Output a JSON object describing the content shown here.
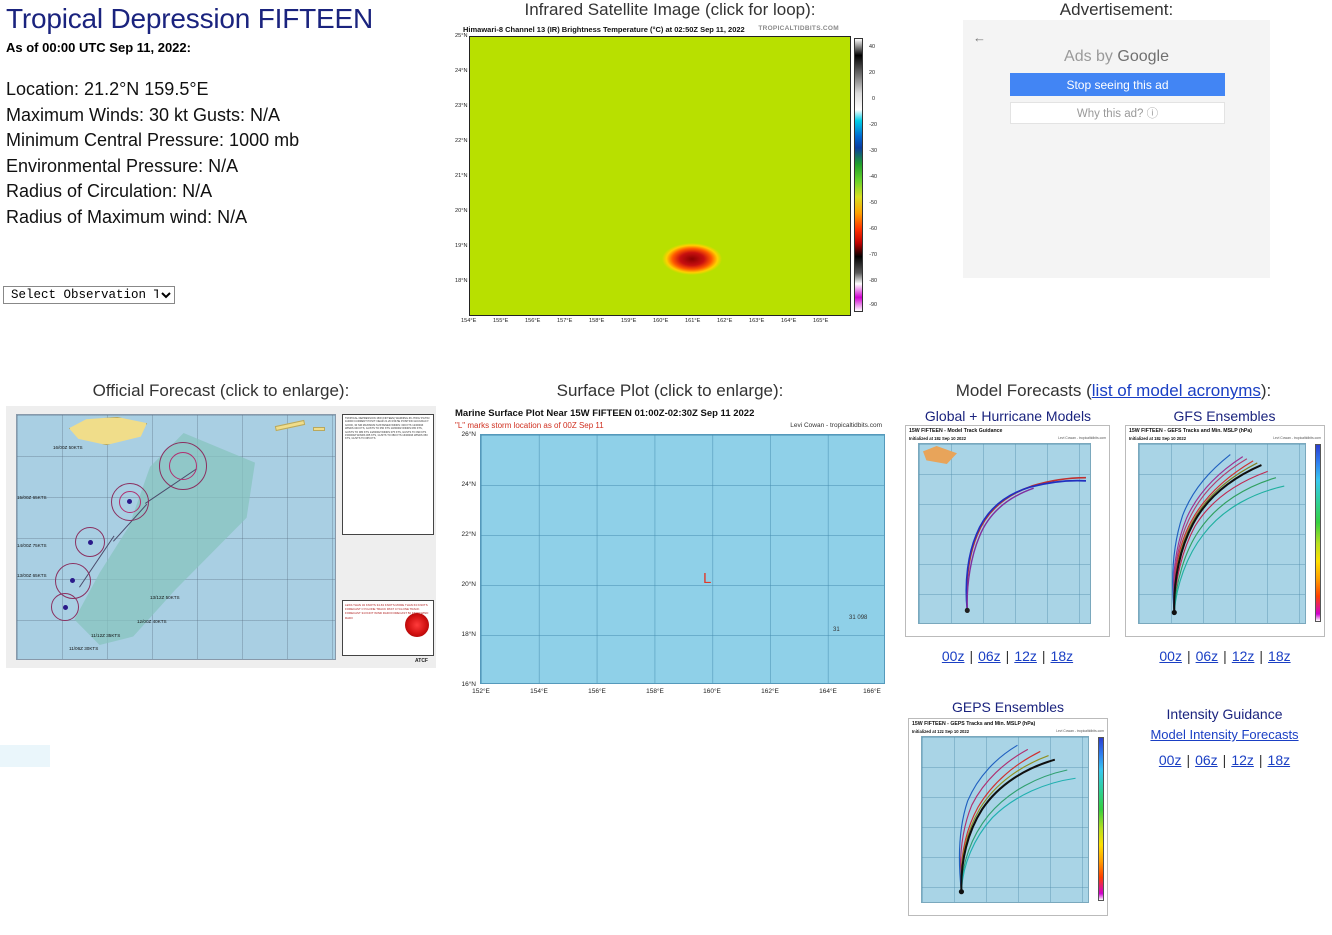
{
  "storm": {
    "title": "Tropical Depression FIFTEEN",
    "as_of": "As of 00:00 UTC Sep 11, 2022:",
    "lines": [
      "Location: 21.2°N 159.5°E",
      "Maximum Winds: 30 kt  Gusts: N/A",
      "Minimum Central Pressure: 1000 mb",
      "Environmental Pressure: N/A",
      "Radius of Circulation: N/A",
      "Radius of Maximum wind: N/A"
    ]
  },
  "satellite": {
    "heading": "Infrared Satellite Image (click for loop):",
    "image_title": "Himawari-8 Channel 13 (IR) Brightness Temperature (°C) at 02:50Z Sep 11, 2022",
    "credit": "TROPICALTIDBITS.COM",
    "y_ticks": [
      "25°N",
      "24°N",
      "23°N",
      "22°N",
      "21°N",
      "20°N",
      "19°N",
      "18°N"
    ],
    "x_ticks": [
      "154°E",
      "155°E",
      "156°E",
      "157°E",
      "158°E",
      "159°E",
      "160°E",
      "161°E",
      "162°E",
      "163°E",
      "164°E",
      "165°E"
    ],
    "colorbar_ticks": [
      "40",
      "20",
      "0",
      "-20",
      "-30",
      "-40",
      "-50",
      "-60",
      "-70",
      "-80",
      "-90"
    ]
  },
  "advertisement": {
    "heading": "Advertisement:",
    "back_icon": "back-arrow-icon",
    "ads_by": "Ads by ",
    "ads_by_brand": "Google",
    "stop_button": "Stop seeing this ad",
    "why_button": "Why this ad? ⓘ"
  },
  "forecast": {
    "heading": "Official Forecast (click to enlarge):",
    "atcf_label": "ATCF",
    "track_labels": [
      "16/00Z  50KTS",
      "15/00Z  65KTS",
      "14/00Z  75KTS",
      "13/00Z  65KTS",
      "13/12Z  50KTS",
      "12/00Z  40KTS",
      "11/12Z  35KTS",
      "11/06Z  30KTS"
    ],
    "info_text": "TROPICAL DEPRESSION 15W (FIFTEEN) WARNING #6\nJTWC/ PGTW/ 110000\nCURRENT POSIT: NEAR 21.2N 159.5E\nPOSITION ACCURACY: GOOD, 30 NM\nMAXIMUM SUSTAINED WINDS: 030 KTS\n12/0000Z WINDS 040 KTS, GUSTS TO 050 KTS\n13/0000Z WINDS 065 KTS, GUSTS TO 080 KTS\n14/0000Z WINDS 075 KTS, GUSTS TO 090 KTS\n15/0000Z WINDS 065 KTS, GUSTS TO 080 KTS\n16/0000Z WINDS 050 KTS, GUSTS TO 065 KTS",
    "legend_text": "LESS THAN 34 KNOTS\n34-63 KNOTS\nMORE THAN 63 KNOTS\nFORECAST CYCLONE TRACK\nPAST CYCLONE TRACK\nFORECAST 34 KNOT WIND RADII\nFORECAST 50 KNOT WIND RADII"
  },
  "surface": {
    "heading": "Surface Plot (click to enlarge):",
    "title": "Marine Surface Plot Near 15W FIFTEEN 01:00Z-02:30Z Sep 11 2022",
    "subtitle": "\"L\" marks storm location as of 00Z Sep 11",
    "credit": "Levi Cowan - tropicaltidbits.com",
    "low_marker": "L",
    "y_ticks": [
      "26°N",
      "24°N",
      "22°N",
      "20°N",
      "18°N",
      "16°N"
    ],
    "x_ticks": [
      "152°E",
      "154°E",
      "156°E",
      "158°E",
      "160°E",
      "162°E",
      "164°E",
      "166°E"
    ],
    "station_values": [
      "31",
      "098",
      "31"
    ],
    "select_value": "Select Observation Time...",
    "select_options": [
      "Select Observation Time..."
    ]
  },
  "models": {
    "heading_prefix": "Model Forecasts (",
    "heading_link": "list of model acronyms",
    "heading_suffix": "):",
    "global_models": {
      "label": "Global + Hurricane Models",
      "chart_title": "15W FIFTEEN - Model Track Guidance",
      "chart_sub": "Initialized at 18z Sep 10 2022",
      "credit": "Levi Cowan - tropicaltidbits.com",
      "times": [
        "00z",
        "06z",
        "12z",
        "18z"
      ]
    },
    "gfs_ensembles": {
      "label": "GFS Ensembles",
      "chart_title": "15W FIFTEEN - GEFS Tracks and Min. MSLP (hPa)",
      "chart_sub": "Initialized at 18z Sep 10 2022",
      "credit": "Levi Cowan - tropicaltidbits.com",
      "times": [
        "00z",
        "06z",
        "12z",
        "18z"
      ]
    },
    "geps_ensembles": {
      "label": "GEPS Ensembles",
      "chart_title": "15W FIFTEEN - GEPS Tracks and Min. MSLP (hPa)",
      "chart_sub": "Initialized at 12z Sep 10 2022",
      "credit": "Levi Cowan - tropicaltidbits.com"
    },
    "intensity": {
      "label": "Intensity Guidance",
      "link": "Model Intensity Forecasts",
      "times": [
        "00z",
        "06z",
        "12z",
        "18z"
      ]
    },
    "separator": "|"
  }
}
